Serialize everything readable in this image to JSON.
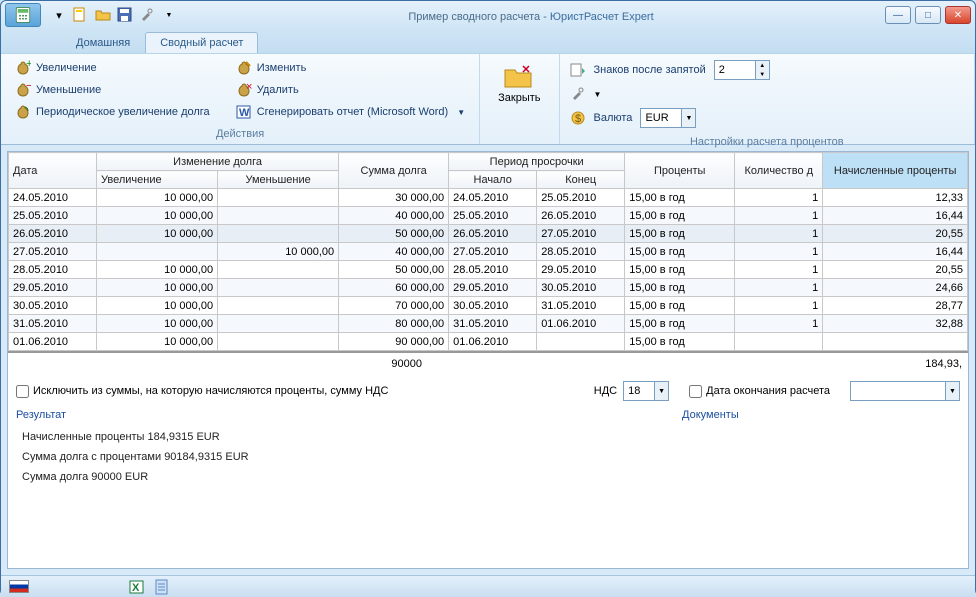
{
  "title_prefix": "Пример сводного расчета - ",
  "title_app": "ЮристРасчет Expert",
  "tabs": {
    "home": "Домашняя",
    "summary": "Сводный расчет"
  },
  "ribbon": {
    "increase": "Увеличение",
    "decrease": "Уменьшение",
    "periodic": "Периодическое увеличение долга",
    "edit": "Изменить",
    "delete": "Удалить",
    "report": "Сгенерировать отчет (Microsoft Word)",
    "close": "Закрыть",
    "actions_label": "Действия",
    "decimals_label": "Знаков после запятой",
    "decimals_value": "2",
    "currency_label": "Валюта",
    "currency_value": "EUR",
    "settings_label": "Настройки расчета процентов"
  },
  "grid": {
    "headers": {
      "date": "Дата",
      "change": "Изменение долга",
      "inc": "Увеличение",
      "dec": "Уменьшение",
      "sum": "Сумма долга",
      "period": "Период просрочки",
      "start": "Начало",
      "end": "Конец",
      "percent": "Проценты",
      "count": "Количество д",
      "accrued": "Начисленные проценты"
    },
    "rows": [
      {
        "date": "24.05.2010",
        "inc": "10 000,00",
        "dec": "",
        "sum": "30 000,00",
        "start": "24.05.2010",
        "end": "25.05.2010",
        "pct": "15,00 в год",
        "cnt": "1",
        "acc": "12,33"
      },
      {
        "date": "25.05.2010",
        "inc": "10 000,00",
        "dec": "",
        "sum": "40 000,00",
        "start": "25.05.2010",
        "end": "26.05.2010",
        "pct": "15,00 в год",
        "cnt": "1",
        "acc": "16,44"
      },
      {
        "date": "26.05.2010",
        "inc": "10 000,00",
        "dec": "",
        "sum": "50 000,00",
        "start": "26.05.2010",
        "end": "27.05.2010",
        "pct": "15,00 в год",
        "cnt": "1",
        "acc": "20,55"
      },
      {
        "date": "27.05.2010",
        "inc": "",
        "dec": "10 000,00",
        "sum": "40 000,00",
        "start": "27.05.2010",
        "end": "28.05.2010",
        "pct": "15,00 в год",
        "cnt": "1",
        "acc": "16,44"
      },
      {
        "date": "28.05.2010",
        "inc": "10 000,00",
        "dec": "",
        "sum": "50 000,00",
        "start": "28.05.2010",
        "end": "29.05.2010",
        "pct": "15,00 в год",
        "cnt": "1",
        "acc": "20,55"
      },
      {
        "date": "29.05.2010",
        "inc": "10 000,00",
        "dec": "",
        "sum": "60 000,00",
        "start": "29.05.2010",
        "end": "30.05.2010",
        "pct": "15,00 в год",
        "cnt": "1",
        "acc": "24,66"
      },
      {
        "date": "30.05.2010",
        "inc": "10 000,00",
        "dec": "",
        "sum": "70 000,00",
        "start": "30.05.2010",
        "end": "31.05.2010",
        "pct": "15,00 в год",
        "cnt": "1",
        "acc": "28,77"
      },
      {
        "date": "31.05.2010",
        "inc": "10 000,00",
        "dec": "",
        "sum": "80 000,00",
        "start": "31.05.2010",
        "end": "01.06.2010",
        "pct": "15,00 в год",
        "cnt": "1",
        "acc": "32,88"
      },
      {
        "date": "01.06.2010",
        "inc": "10 000,00",
        "dec": "",
        "sum": "90 000,00",
        "start": "01.06.2010",
        "end": "",
        "pct": "15,00 в год",
        "cnt": "",
        "acc": ""
      }
    ],
    "totals": {
      "sum": "90000",
      "acc": "184,93,"
    }
  },
  "filters": {
    "exclude_vat": "Исключить из суммы, на которую начисляются проценты, сумму НДС",
    "vat_label": "НДС",
    "vat_value": "18",
    "end_date": "Дата окончания расчета"
  },
  "links": {
    "result": "Результат",
    "documents": "Документы"
  },
  "results": {
    "l1": "Начисленные проценты 184,9315 EUR",
    "l2": "Сумма долга с процентами 90184,9315 EUR",
    "l3": "Сумма долга 90000 EUR"
  }
}
